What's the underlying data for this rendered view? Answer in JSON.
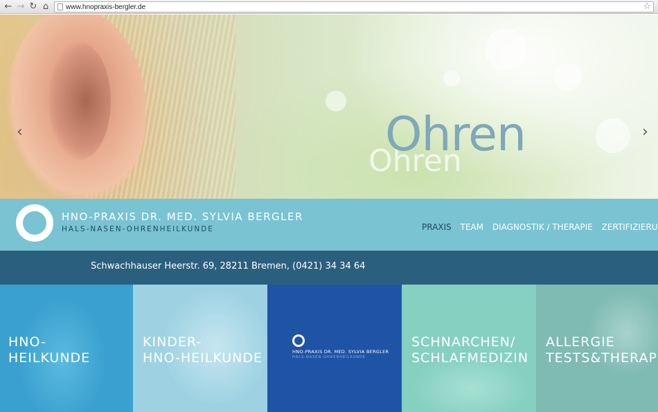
{
  "browser": {
    "url": "www.hnopraxis-bergler.de",
    "back_icon": "back-arrow-icon",
    "forward_icon": "forward-arrow-icon",
    "reload_icon": "reload-icon",
    "home_icon": "home-icon",
    "star_icon": "star-icon"
  },
  "hero": {
    "title": "Ohren",
    "title_echo": "Ohren",
    "prev_icon": "chevron-left-icon",
    "next_icon": "chevron-right-icon"
  },
  "header": {
    "brand_name": "HNO-PRAXIS DR. MED. SYLVIA BERGLER",
    "brand_sub": "HALS-NASEN-OHRENHEILKUNDE",
    "nav": [
      "PRAXIS",
      "TEAM",
      "DIAGNOSTIK / THERAPIE",
      "ZERTIFIZIERUNGEN"
    ],
    "colors": {
      "band": "#79c3d3",
      "dark": "#1f4a66"
    }
  },
  "address": {
    "text": "Schwachhauser Heerstr. 69, 28211 Bremen, (0421) 34 34 64"
  },
  "tiles": [
    {
      "line1": "HNO-",
      "line2": "HEILKUNDE"
    },
    {
      "line1": "KINDER-",
      "line2": "HNO-HEILKUNDE"
    },
    {
      "logo_name": "HNO-PRAXIS DR. MED. SYLVIA BERGLER",
      "logo_sub": "HALS-NASEN-OHRENHEILKUNDE"
    },
    {
      "line1": "SCHNARCHEN/",
      "line2": "SCHLAFMEDIZIN"
    },
    {
      "line1": "ALLERGIE",
      "line2": "TESTS&THERAPIE"
    }
  ]
}
